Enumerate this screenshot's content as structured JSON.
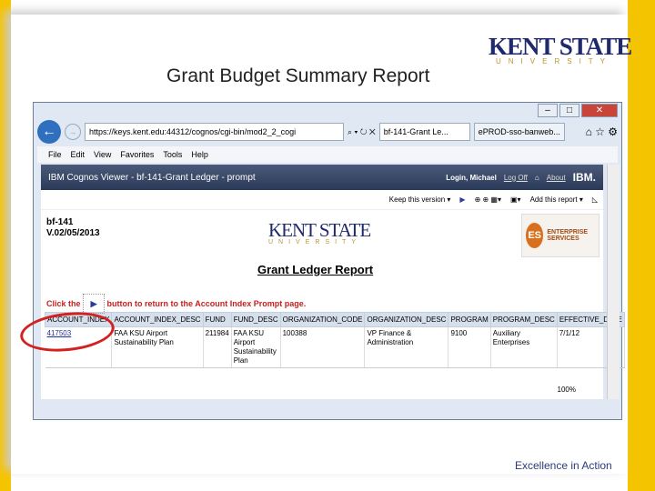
{
  "slide": {
    "title": "Grant Budget Summary Report",
    "logo": "KENT STATE",
    "logo_sub": "UNIVERSITY",
    "tagline": "Excellence in Action"
  },
  "browser": {
    "url": "https://keys.kent.edu:44312/cognos/cgi-bin/mod2_2_cogi",
    "tabs": [
      "bf-141-Grant Le...",
      "ePROD-sso-banweb..."
    ],
    "menu": [
      "File",
      "Edit",
      "View",
      "Favorites",
      "Tools",
      "Help"
    ],
    "zoom": "100%"
  },
  "cognos": {
    "title": "IBM Cognos Viewer - bf-141-Grant Ledger - prompt",
    "user": "Login, Michael",
    "logoff": "Log Off",
    "about": "About",
    "ibm": "IBM.",
    "keep": "Keep this version ▾",
    "add": "Add this report ▾"
  },
  "report": {
    "id": "bf-141",
    "version": "V.02/05/2013",
    "logo": "KENT STATE",
    "logo_sub": "UNIVERSITY",
    "es_logo": "ENTERPRISE SERVICES",
    "title": "Grant Ledger Report",
    "click_pre": "Click the",
    "click_post": "button to return to the Account Index Prompt page.",
    "columns": [
      "ACCOUNT_INDEX",
      "ACCOUNT_INDEX_DESC",
      "FUND",
      "FUND_DESC",
      "ORGANIZATION_CODE",
      "ORGANIZATION_DESC",
      "PROGRAM",
      "PROGRAM_DESC",
      "EFFECTIVE_DATE"
    ],
    "row": [
      "417503",
      "FAA KSU Airport Sustainability Plan",
      "211984",
      "FAA KSU Airport Sustainability Plan",
      "100388",
      "VP Finance & Administration",
      "9100",
      "Auxiliary Enterprises",
      "7/1/12"
    ]
  }
}
